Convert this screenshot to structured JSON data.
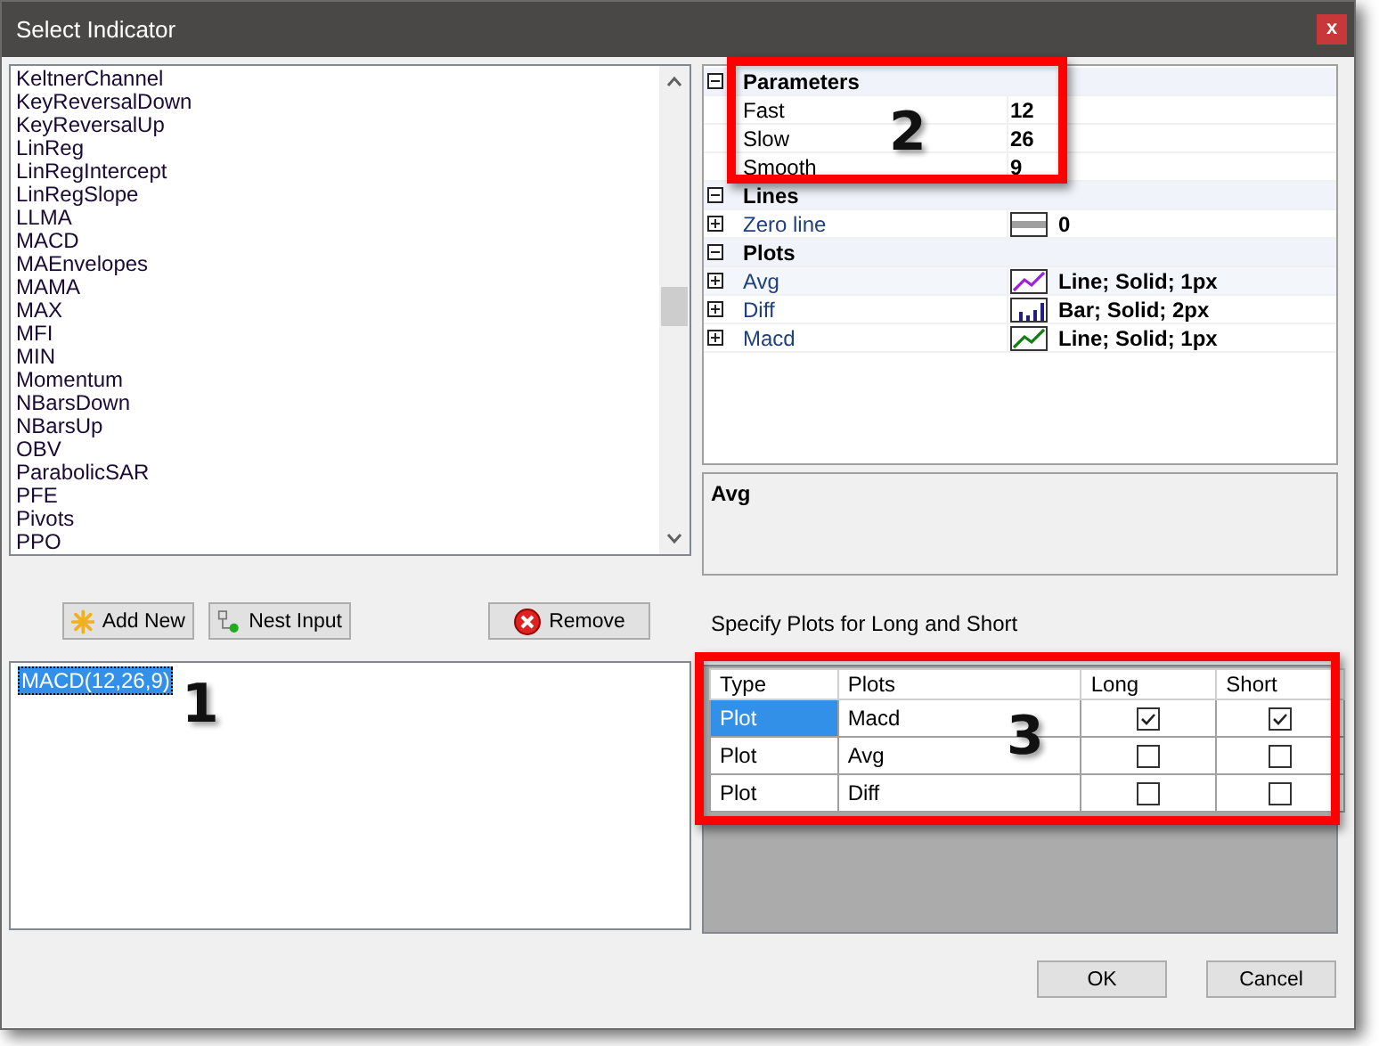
{
  "window": {
    "title": "Select Indicator",
    "close": "x"
  },
  "indicators": [
    "KeltnerChannel",
    "KeyReversalDown",
    "KeyReversalUp",
    "LinReg",
    "LinRegIntercept",
    "LinRegSlope",
    "LLMA",
    "MACD",
    "MAEnvelopes",
    "MAMA",
    "MAX",
    "MFI",
    "MIN",
    "Momentum",
    "NBarsDown",
    "NBarsUp",
    "OBV",
    "ParabolicSAR",
    "PFE",
    "Pivots",
    "PPO"
  ],
  "buttons": [
    {
      "label": "Add New",
      "kind": "add"
    },
    {
      "label": "Nest Input",
      "kind": "nest"
    },
    {
      "label": "Remove",
      "kind": "remove"
    }
  ],
  "applied": [
    {
      "label": "MACD(12,26,9)",
      "selected": true
    }
  ],
  "properties": [
    {
      "title": "Parameters",
      "expanded": true,
      "rows": [
        {
          "name": "Fast",
          "value": "12"
        },
        {
          "name": "Slow",
          "value": "26"
        },
        {
          "name": "Smooth",
          "value": "9"
        }
      ]
    },
    {
      "title": "Lines",
      "expanded": true,
      "rows": [
        {
          "name": "Zero line",
          "value": "0",
          "kind": "hline",
          "color": "#a0a0a0",
          "expanded": false,
          "selected": false
        }
      ]
    },
    {
      "title": "Plots",
      "expanded": true,
      "rows": [
        {
          "name": "Avg",
          "value": "Line; Solid; 1px",
          "kind": "line",
          "color": "#a020e0",
          "expanded": false,
          "selected": true
        },
        {
          "name": "Diff",
          "value": "Bar; Solid; 2px",
          "kind": "bar",
          "color": "#20207f",
          "expanded": false,
          "selected": false
        },
        {
          "name": "Macd",
          "value": "Line; Solid; 1px",
          "kind": "line",
          "color": "#108010",
          "expanded": false,
          "selected": false
        }
      ]
    }
  ],
  "description": {
    "title": "Avg"
  },
  "plots_label": "Specify Plots for Long and Short",
  "plot_table": {
    "columns": [
      "Type",
      "Plots",
      "Long",
      "Short"
    ],
    "rows": [
      {
        "type": "Plot",
        "plot": "Macd",
        "long": true,
        "short": true,
        "selected": true
      },
      {
        "type": "Plot",
        "plot": "Avg",
        "long": false,
        "short": false,
        "selected": false
      },
      {
        "type": "Plot",
        "plot": "Diff",
        "long": false,
        "short": false,
        "selected": false
      }
    ]
  },
  "footer": [
    {
      "label": "OK"
    },
    {
      "label": "Cancel"
    }
  ],
  "annotations": [
    {
      "label": "1",
      "kind": "number"
    },
    {
      "label": "2",
      "kind": "framed"
    },
    {
      "label": "3",
      "kind": "framed"
    }
  ]
}
